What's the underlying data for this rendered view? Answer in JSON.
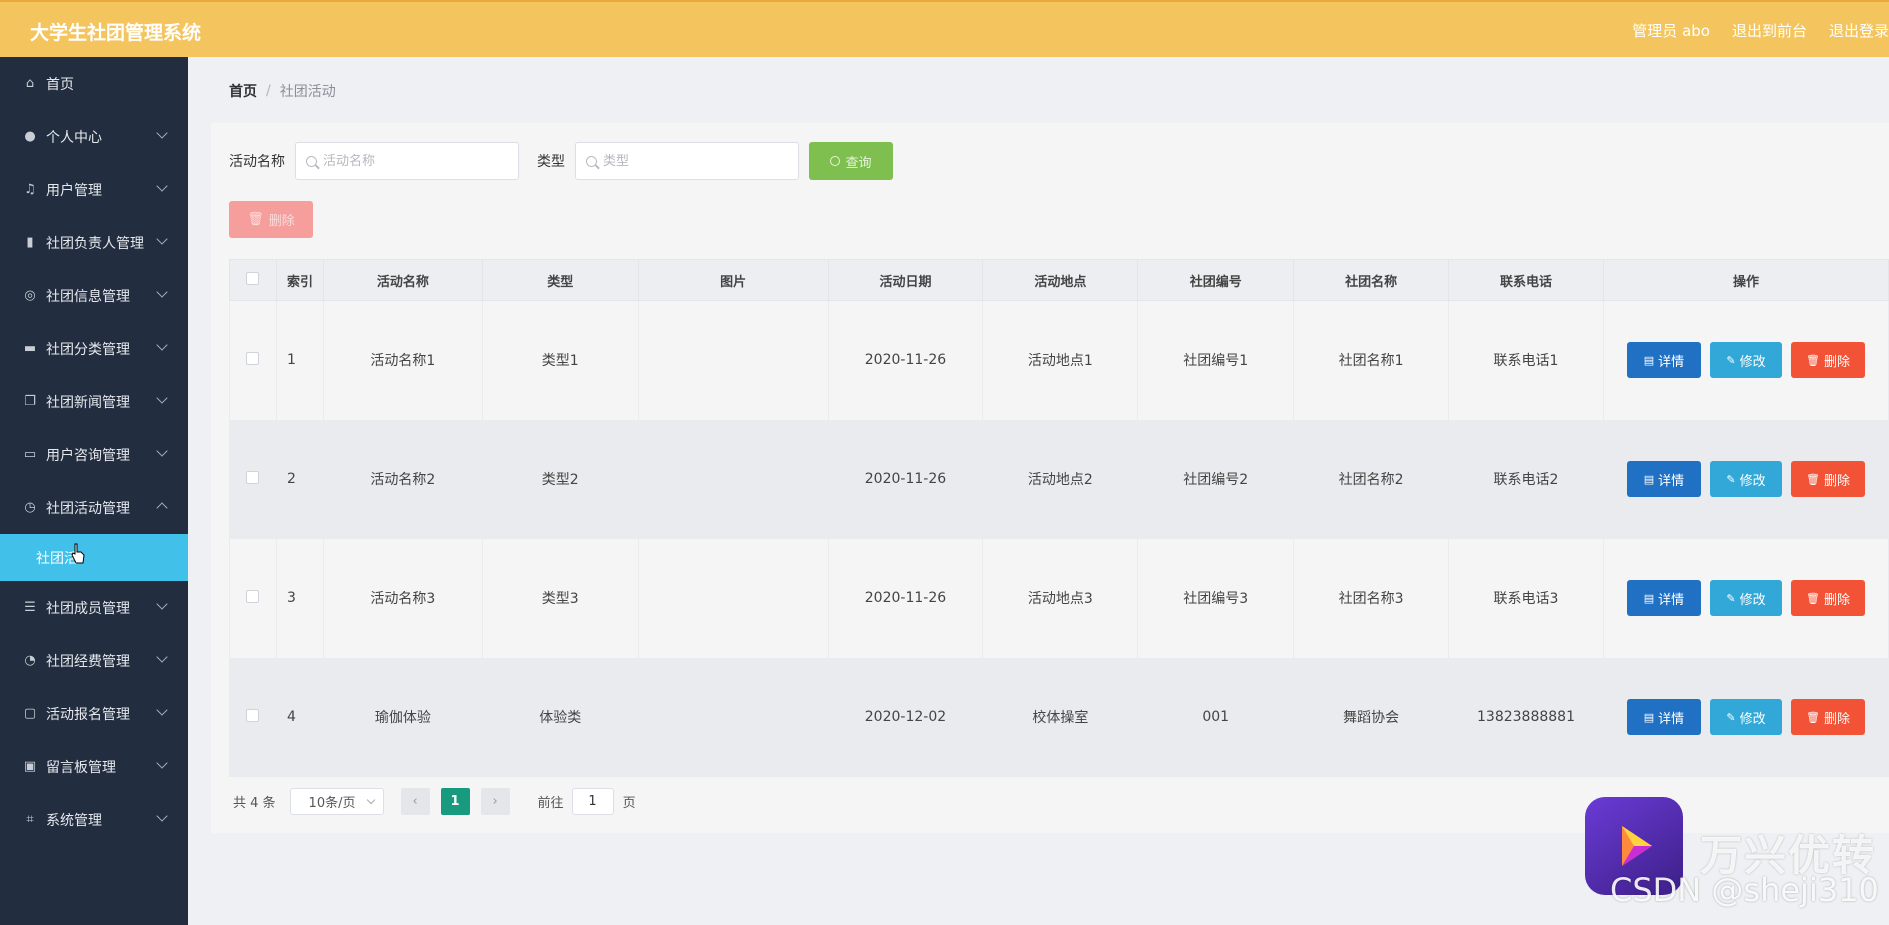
{
  "header": {
    "title": "大学生社团管理系统",
    "admin": "管理员 abo",
    "exit_front": "退出到前台",
    "logout": "退出登录"
  },
  "sidebar": {
    "items": [
      {
        "label": "首页",
        "icon": "home-icon"
      },
      {
        "label": "个人中心",
        "icon": "user-icon"
      },
      {
        "label": "用户管理",
        "icon": "mic-icon"
      },
      {
        "label": "社团负责人管理",
        "icon": "bar-chart-icon"
      },
      {
        "label": "社团信息管理",
        "icon": "compass-icon"
      },
      {
        "label": "社团分类管理",
        "icon": "monitor-icon"
      },
      {
        "label": "社团新闻管理",
        "icon": "copy-icon"
      },
      {
        "label": "用户咨询管理",
        "icon": "chat-icon"
      },
      {
        "label": "社团活动管理",
        "icon": "clock-icon"
      },
      {
        "label": "社团成员管理",
        "icon": "list-icon"
      },
      {
        "label": "社团经费管理",
        "icon": "gauge-icon"
      },
      {
        "label": "活动报名管理",
        "icon": "message-icon"
      },
      {
        "label": "留言板管理",
        "icon": "briefcase-icon"
      },
      {
        "label": "系统管理",
        "icon": "crop-icon"
      }
    ],
    "active_sub": "社团活"
  },
  "breadcrumb": {
    "home": "首页",
    "separator": "/",
    "current": "社团活动"
  },
  "search": {
    "name_label": "活动名称",
    "name_placeholder": "活动名称",
    "type_label": "类型",
    "type_placeholder": "类型",
    "query_label": "查询",
    "delete_label": "删除"
  },
  "table": {
    "headers": [
      "索引",
      "活动名称",
      "类型",
      "图片",
      "活动日期",
      "活动地点",
      "社团编号",
      "社团名称",
      "联系电话",
      "操作"
    ],
    "rows": [
      {
        "idx": "1",
        "name": "活动名称1",
        "type": "类型1",
        "date": "2020-11-26",
        "place": "活动地点1",
        "code": "社团编号1",
        "club": "社团名称1",
        "phone": "联系电话1"
      },
      {
        "idx": "2",
        "name": "活动名称2",
        "type": "类型2",
        "date": "2020-11-26",
        "place": "活动地点2",
        "code": "社团编号2",
        "club": "社团名称2",
        "phone": "联系电话2"
      },
      {
        "idx": "3",
        "name": "活动名称3",
        "type": "类型3",
        "date": "2020-11-26",
        "place": "活动地点3",
        "code": "社团编号3",
        "club": "社团名称3",
        "phone": "联系电话3"
      },
      {
        "idx": "4",
        "name": "瑜伽体验",
        "type": "体验类",
        "date": "2020-12-02",
        "place": "校体操室",
        "code": "001",
        "club": "舞蹈协会",
        "phone": "13823888881"
      }
    ],
    "actions": {
      "detail": "详情",
      "edit": "修改",
      "delete": "删除"
    }
  },
  "pager": {
    "total": "共 4 条",
    "size": "10条/页",
    "current": "1",
    "goto_label": "前往",
    "goto_value": "1",
    "page_unit": "页"
  },
  "watermark": {
    "brand": "万兴优转",
    "csdn": "CSDN @sheji310"
  },
  "colors": {
    "header": "#f4c55e",
    "sidebar": "#222d3f",
    "active": "#41c0e9",
    "detail": "#2071c4",
    "edit": "#32a8d8",
    "delete": "#f25236",
    "query": "#7ebf4f"
  }
}
